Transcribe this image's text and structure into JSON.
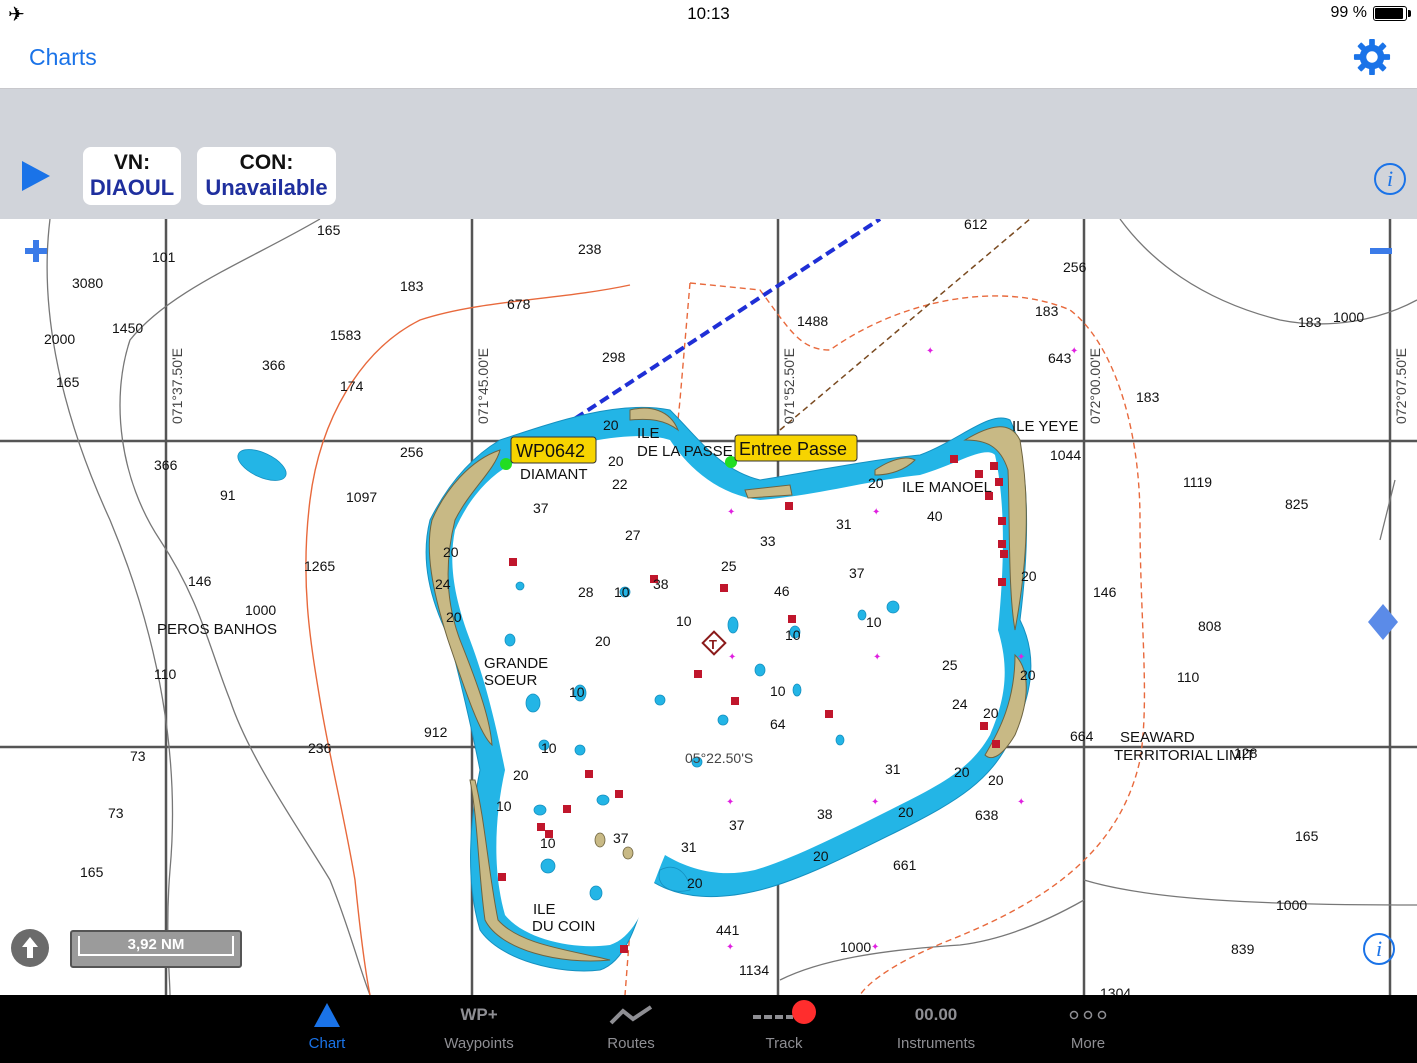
{
  "status_bar": {
    "time": "10:13",
    "battery": "99 %",
    "battery_level": 0.99
  },
  "nav": {
    "back_label": "Charts"
  },
  "info_bar": {
    "cards": [
      {
        "key": "VN:",
        "value": "DIAOUL"
      },
      {
        "key": "CON:",
        "value": "Unavailable"
      }
    ],
    "info_icon": "info-icon"
  },
  "map": {
    "zoom_in": "+",
    "zoom_out": "−",
    "lat_labels": [
      "071°37.50'E",
      "071°45.00'E",
      "071°52.50'E",
      "072°00.00'E",
      "072°07.50'E"
    ],
    "lat_center_label": "05°22.50'S",
    "waypoints": [
      "WP0642",
      "Entree Passe"
    ],
    "place_names": [
      "ILE",
      "DE LA PASSE",
      "DIAMANT",
      "ILE YEYE",
      "ILE MANOEL",
      "PEROS BANHOS",
      "GRANDE",
      "SOEUR",
      "ILE",
      "DU COIN",
      "SEAWARD",
      "TERRITORIAL LIMIT"
    ],
    "scale_label": "3,92 NM"
  },
  "tabs": [
    {
      "label": "Chart",
      "icon": "chart-triangle-icon"
    },
    {
      "label": "Waypoints",
      "icon": "WP+"
    },
    {
      "label": "Routes",
      "icon": "route-icon"
    },
    {
      "label": "Track",
      "icon": "track-icon"
    },
    {
      "label": "Instruments",
      "icon": "00.00"
    },
    {
      "label": "More",
      "icon": "more-dots-icon"
    }
  ]
}
